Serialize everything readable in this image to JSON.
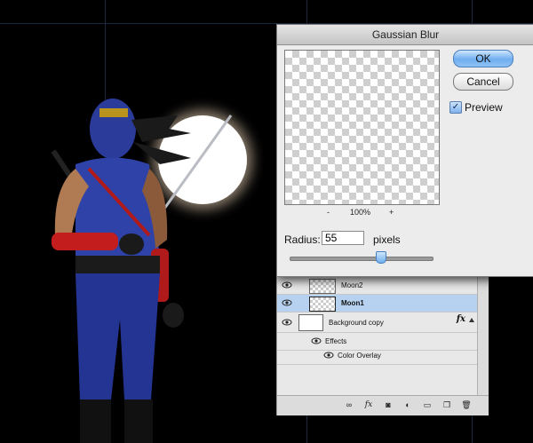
{
  "dialog": {
    "title": "Gaussian Blur",
    "ok_label": "OK",
    "cancel_label": "Cancel",
    "preview_label": "Preview",
    "preview_checked": true,
    "zoom_minus": "-",
    "zoom_value": "100%",
    "zoom_plus": "+",
    "radius_label": "Radius:",
    "radius_value": "55",
    "radius_units": "pixels",
    "accent_color": "#6faef0"
  },
  "layers": {
    "items": [
      {
        "name": "Moon2",
        "thumb": "transparent",
        "selected": false
      },
      {
        "name": "Moon1",
        "thumb": "transparent",
        "selected": true
      },
      {
        "name": "Background copy",
        "thumb": "white",
        "selected": false,
        "fx": "fx"
      }
    ],
    "effects_label": "Effects",
    "effect_items": [
      "Color Overlay"
    ],
    "footer_icons": [
      "link-icon",
      "fx-icon",
      "mask-icon",
      "adjustment-icon",
      "group-icon",
      "new-layer-icon",
      "trash-icon"
    ]
  }
}
